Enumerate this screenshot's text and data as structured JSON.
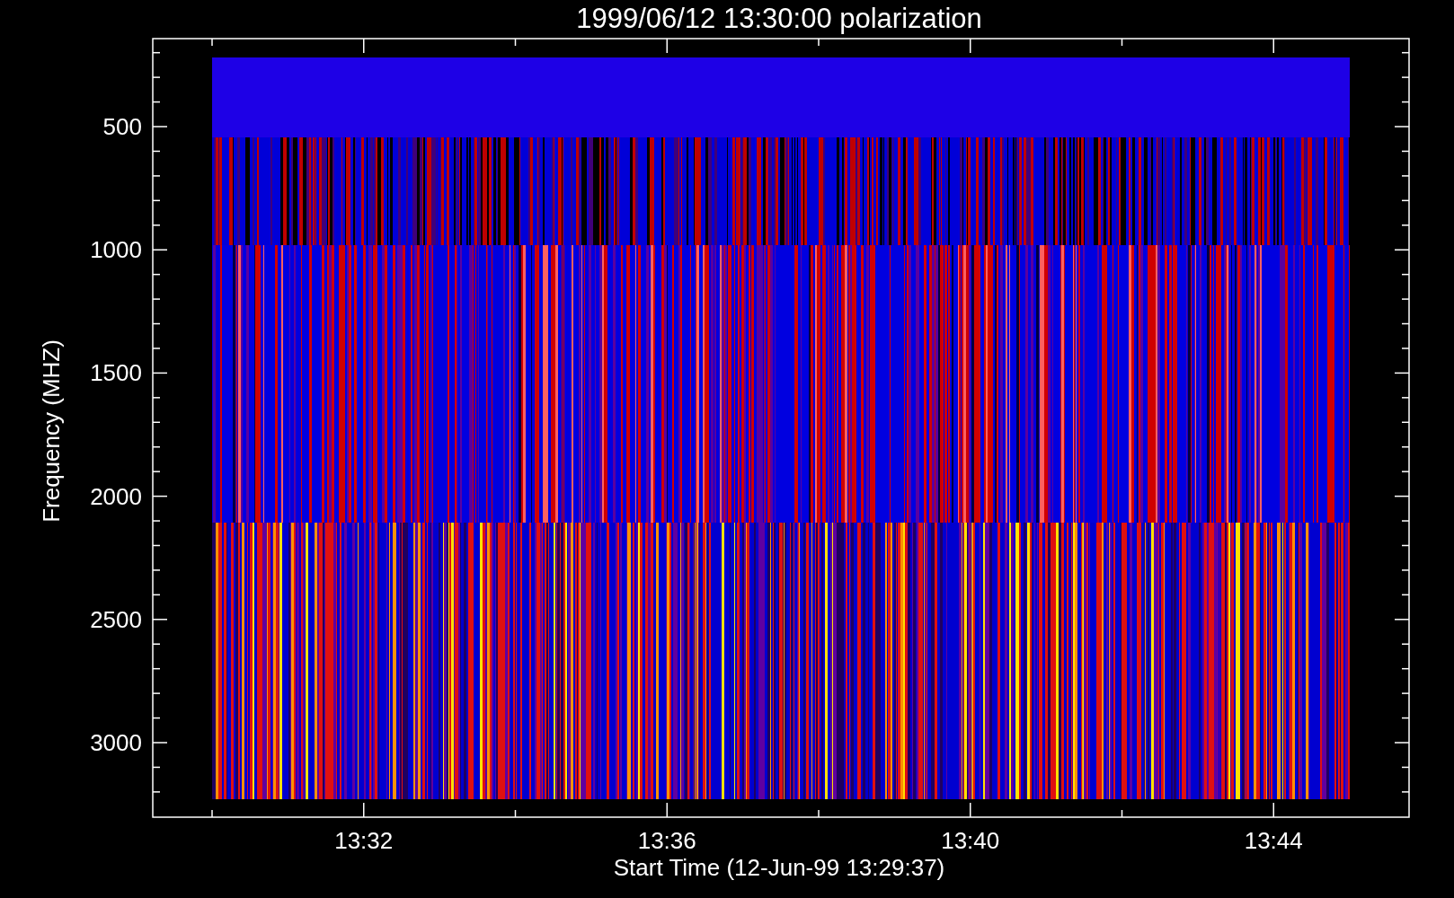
{
  "title": "1999/06/12 13:30:00 polarization",
  "y_axis": {
    "label": "Frequency (MHZ)",
    "tick_labels": [
      "500",
      "1000",
      "1500",
      "2000",
      "2500",
      "3000"
    ]
  },
  "x_axis": {
    "label": "Start Time (12-Jun-99 13:29:37)",
    "tick_labels": [
      "13:32",
      "13:36",
      "13:40",
      "13:44"
    ]
  }
}
